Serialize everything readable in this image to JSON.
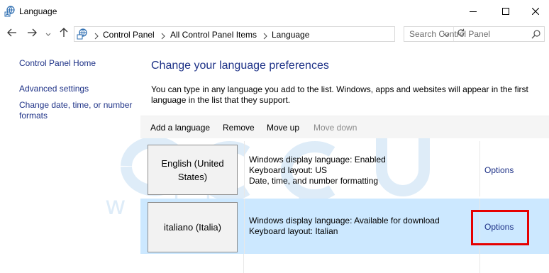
{
  "window": {
    "title": "Language",
    "icons": {
      "app": "globe-language-icon",
      "minimize": "minimize-icon",
      "maximize": "maximize-icon",
      "close": "close-icon"
    }
  },
  "navigation": {
    "back": "back-arrow-icon",
    "forward": "forward-arrow-icon",
    "recent": "chevron-down-icon",
    "up": "up-arrow-icon",
    "breadcrumbs": [
      "Control Panel",
      "All Control Panel Items",
      "Language"
    ],
    "refresh": "refresh-icon",
    "search_placeholder": "Search Control Panel"
  },
  "sidebar": {
    "items": [
      {
        "label": "Control Panel Home"
      },
      {
        "label": "Advanced settings"
      },
      {
        "label": "Change date, time, or number formats"
      }
    ]
  },
  "main": {
    "heading": "Change your language preferences",
    "description": "You can type in any language you add to the list. Windows, apps and websites will appear in the first language in the list that they support.",
    "toolbar": {
      "add": "Add a language",
      "remove": "Remove",
      "move_up": "Move up",
      "move_down": "Move down"
    },
    "languages": [
      {
        "name": "English (United States)",
        "details": [
          "Windows display language: Enabled",
          "Keyboard layout: US",
          "Date, time, and number formatting"
        ],
        "options": "Options",
        "selected": false
      },
      {
        "name": "italiano (Italia)",
        "details": [
          "Windows display language: Available for download",
          "Keyboard layout: Italian"
        ],
        "options": "Options",
        "selected": true
      }
    ]
  },
  "colors": {
    "link": "#1e3287",
    "selected_row": "#cce8ff",
    "toolbar_bg": "#f5f5f5",
    "highlight_box": "#e60000"
  }
}
